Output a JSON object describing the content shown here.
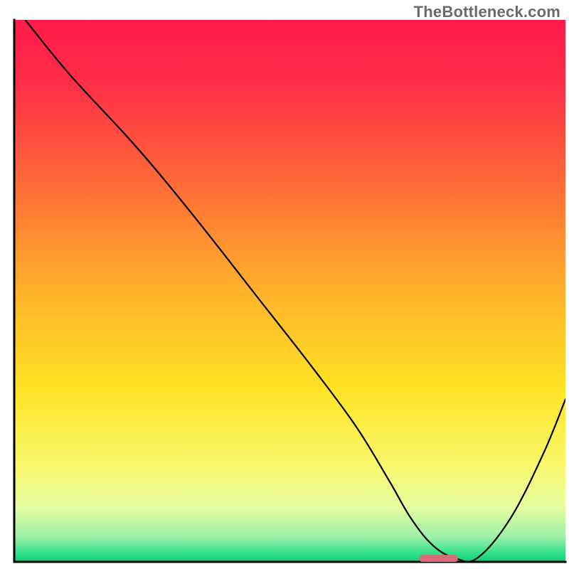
{
  "watermark": {
    "text": "TheBottleneck.com"
  },
  "chart_data": {
    "type": "line",
    "title": "",
    "xlabel": "",
    "ylabel": "",
    "xlim": [
      0,
      100
    ],
    "ylim": [
      0,
      100
    ],
    "grid": false,
    "legend": false,
    "annotations": [],
    "background_gradient": {
      "type": "vertical",
      "stops": [
        {
          "pos": 0.0,
          "color": "#ff1a4b"
        },
        {
          "pos": 0.12,
          "color": "#ff2f47"
        },
        {
          "pos": 0.3,
          "color": "#ff6a39"
        },
        {
          "pos": 0.5,
          "color": "#ffb22a"
        },
        {
          "pos": 0.68,
          "color": "#ffe324"
        },
        {
          "pos": 0.82,
          "color": "#f8f86a"
        },
        {
          "pos": 0.9,
          "color": "#e6fca0"
        },
        {
          "pos": 0.955,
          "color": "#9af0a8"
        },
        {
          "pos": 0.985,
          "color": "#2fe08a"
        },
        {
          "pos": 1.0,
          "color": "#14c97a"
        }
      ]
    },
    "series": [
      {
        "name": "bottleneck-curve",
        "color": "#000000",
        "stroke_width": 2.2,
        "x": [
          2,
          10,
          20,
          26,
          34,
          44,
          54,
          62,
          68,
          72,
          76,
          80,
          84,
          90,
          96,
          100
        ],
        "values": [
          100,
          90,
          79,
          72,
          62,
          49,
          36,
          25,
          15,
          8,
          3,
          0.7,
          0.7,
          8,
          20,
          30
        ]
      }
    ],
    "markers": [
      {
        "name": "optimum-marker",
        "shape": "rounded-rect",
        "color": "#dd6b77",
        "x_center": 77,
        "y_center": 0.6,
        "width": 7,
        "height": 1.4
      }
    ],
    "axes": {
      "left": {
        "color": "#000000",
        "width": 3
      },
      "bottom": {
        "color": "#000000",
        "width": 3
      }
    }
  }
}
